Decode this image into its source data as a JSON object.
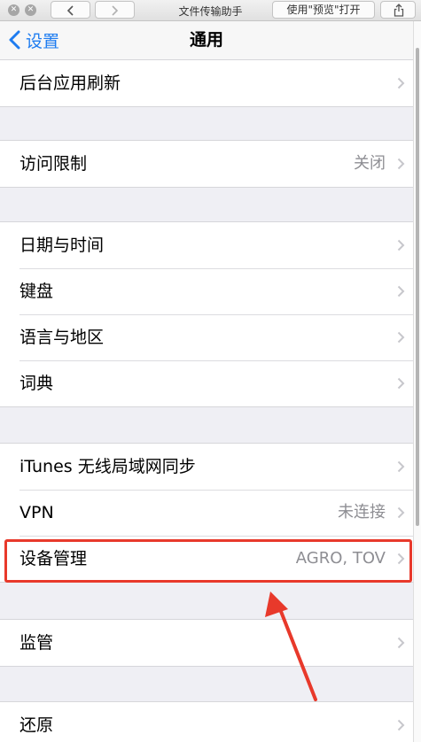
{
  "window": {
    "title": "文件传输助手",
    "open_with_label": "使用\"预览\"打开"
  },
  "nav": {
    "back_label": "设置",
    "title": "通用"
  },
  "groups": [
    {
      "rows": [
        {
          "label": "后台应用刷新",
          "value": ""
        }
      ]
    },
    {
      "rows": [
        {
          "label": "访问限制",
          "value": "关闭"
        }
      ]
    },
    {
      "rows": [
        {
          "label": "日期与时间",
          "value": ""
        },
        {
          "label": "键盘",
          "value": ""
        },
        {
          "label": "语言与地区",
          "value": ""
        },
        {
          "label": "词典",
          "value": ""
        }
      ]
    },
    {
      "rows": [
        {
          "label": "iTunes 无线局域网同步",
          "value": ""
        },
        {
          "label": "VPN",
          "value": "未连接"
        },
        {
          "label": "设备管理",
          "value": "AGRO, TOV"
        }
      ]
    },
    {
      "rows": [
        {
          "label": "监管",
          "value": ""
        }
      ]
    },
    {
      "rows": [
        {
          "label": "还原",
          "value": ""
        }
      ]
    }
  ],
  "icons": {
    "close": "close-icon",
    "minimize": "minimize-icon",
    "back": "chevron-left-icon",
    "forward": "chevron-right-icon",
    "share": "share-icon",
    "disclosure": "chevron-right-icon"
  },
  "colors": {
    "accent": "#1e7cf0",
    "highlight": "#e8392b",
    "background": "#efeff4"
  }
}
